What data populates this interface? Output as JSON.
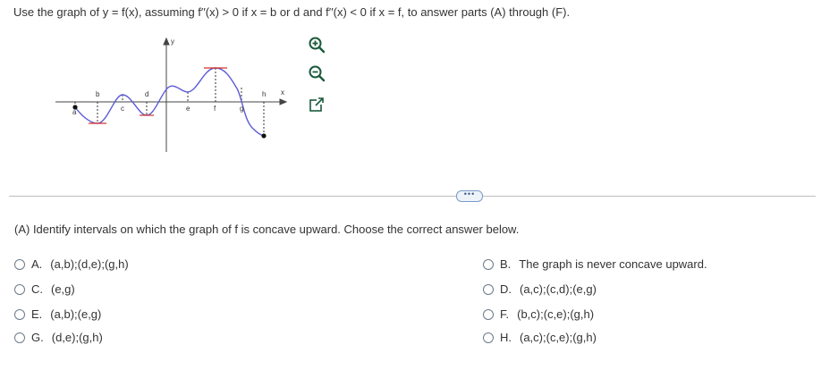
{
  "question": {
    "header": "Use the graph of y = f(x), assuming f′′(x) > 0 if x = b or d and f′′(x) < 0 if x = f, to answer parts (A) through (F)."
  },
  "graph": {
    "y_label": "y",
    "x_label": "x",
    "point_labels": {
      "a": "a",
      "b": "b",
      "c": "c",
      "d": "d",
      "e": "e",
      "f": "f",
      "g": "g",
      "h": "h"
    },
    "curve_color": "#5b5bd6",
    "tangent_color": "#d9302b",
    "tools": [
      "zoom-in-icon",
      "zoom-out-icon",
      "popout-icon"
    ]
  },
  "more_button": "•••",
  "part_a": {
    "prompt": "(A) Identify intervals on which the graph of f is concave upward. Choose the correct answer below."
  },
  "options": [
    {
      "letter": "A.",
      "text": "(a,b);(d,e);(g,h)"
    },
    {
      "letter": "B.",
      "text": "The graph is never concave upward."
    },
    {
      "letter": "C.",
      "text": "(e,g)"
    },
    {
      "letter": "D.",
      "text": "(a,c);(c,d);(e,g)"
    },
    {
      "letter": "E.",
      "text": "(a,b);(e,g)"
    },
    {
      "letter": "F.",
      "text": "(b,c);(c,e);(g,h)"
    },
    {
      "letter": "G.",
      "text": "(d,e);(g,h)"
    },
    {
      "letter": "H.",
      "text": "(a,c);(c,e);(g,h)"
    }
  ]
}
